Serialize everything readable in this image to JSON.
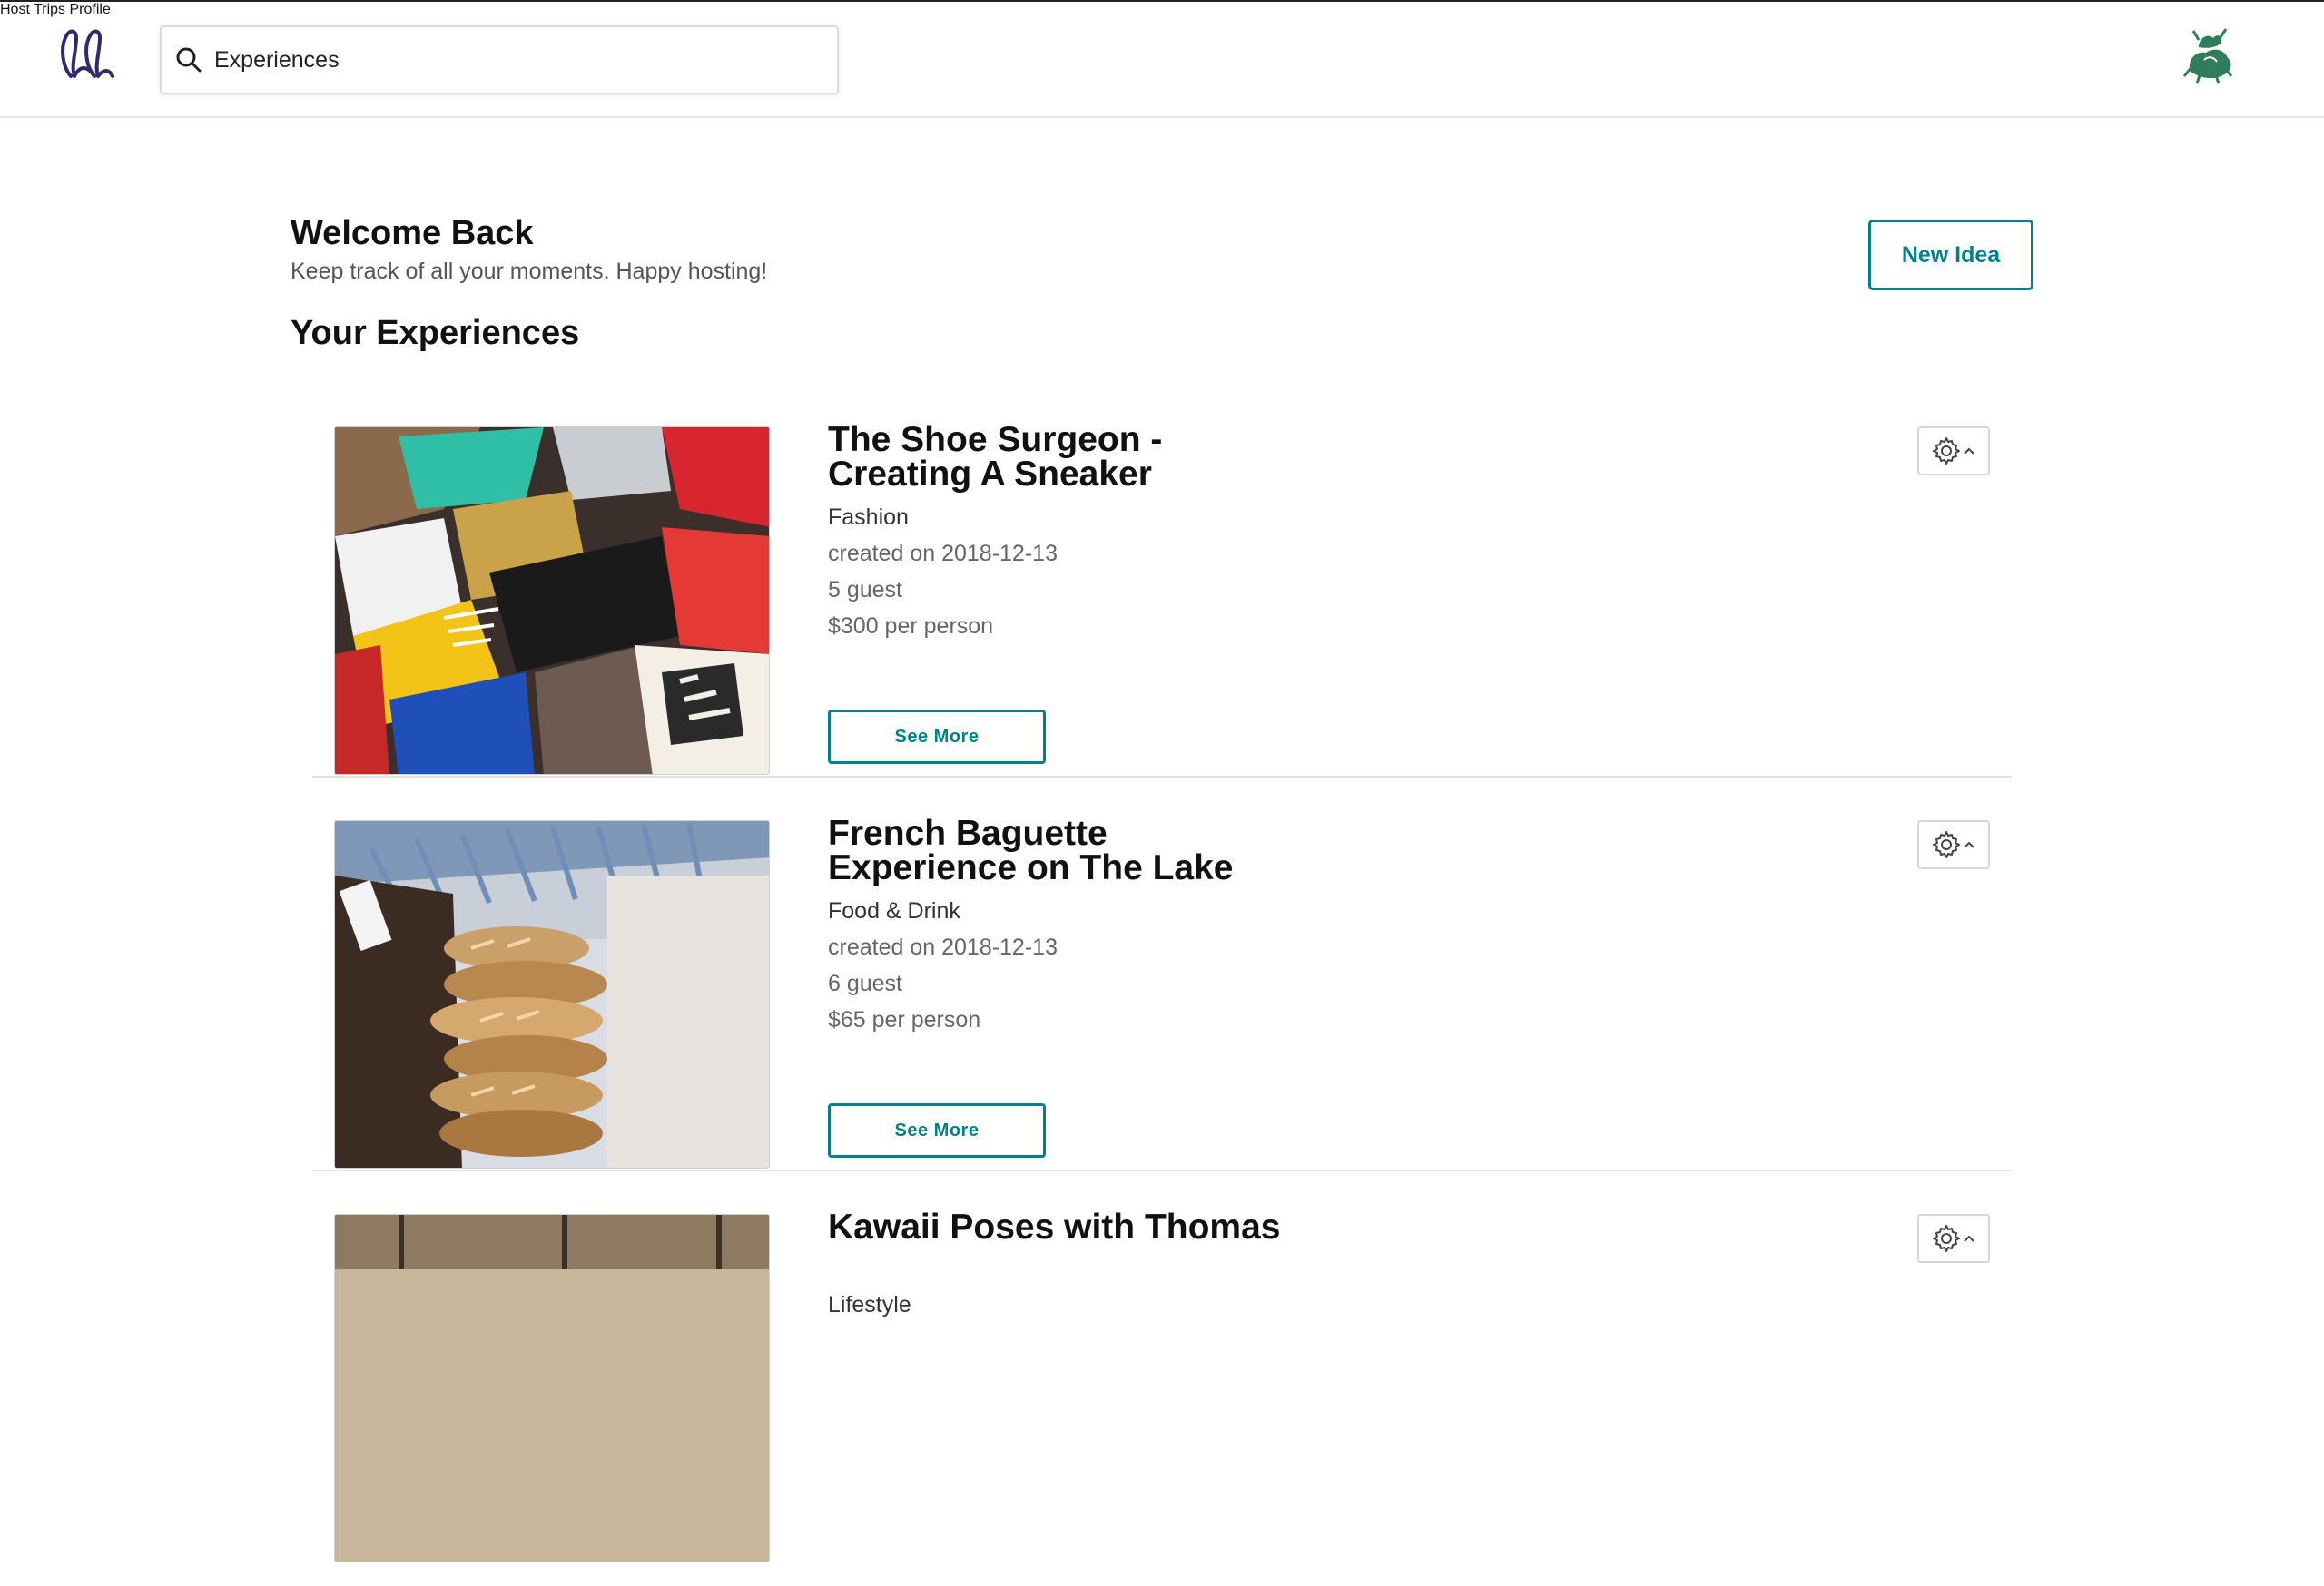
{
  "header": {
    "search": {
      "value": "Experiences",
      "placeholder": "Experiences"
    },
    "nav": [
      {
        "label": "Host"
      },
      {
        "label": "Trips"
      },
      {
        "label": "Profile"
      }
    ],
    "brand_color": "#2d2a6e"
  },
  "main": {
    "welcome_title": "Welcome Back",
    "welcome_subtitle": "Keep track of all your moments. Happy hosting!",
    "new_idea_label": "New Idea",
    "section_title": "Your Experiences",
    "accent_color": "#00828a",
    "experiences": [
      {
        "title": "The Shoe Surgeon - Creating A Sneaker",
        "category": "Fashion",
        "created": "created on 2018-12-13",
        "guests": "5 guest",
        "price": "$300 per person",
        "button": "See More",
        "image": "sneakers-photo"
      },
      {
        "title": "French Baguette Experience on The Lake",
        "category": "Food & Drink",
        "created": "created on 2018-12-13",
        "guests": "6 guest",
        "price": "$65 per person",
        "button": "See More",
        "image": "baguettes-photo"
      },
      {
        "title": "Kawaii Poses with Thomas",
        "category": "Lifestyle",
        "created": "",
        "guests": "",
        "price": "",
        "button": "",
        "image": "room-photo"
      }
    ]
  }
}
